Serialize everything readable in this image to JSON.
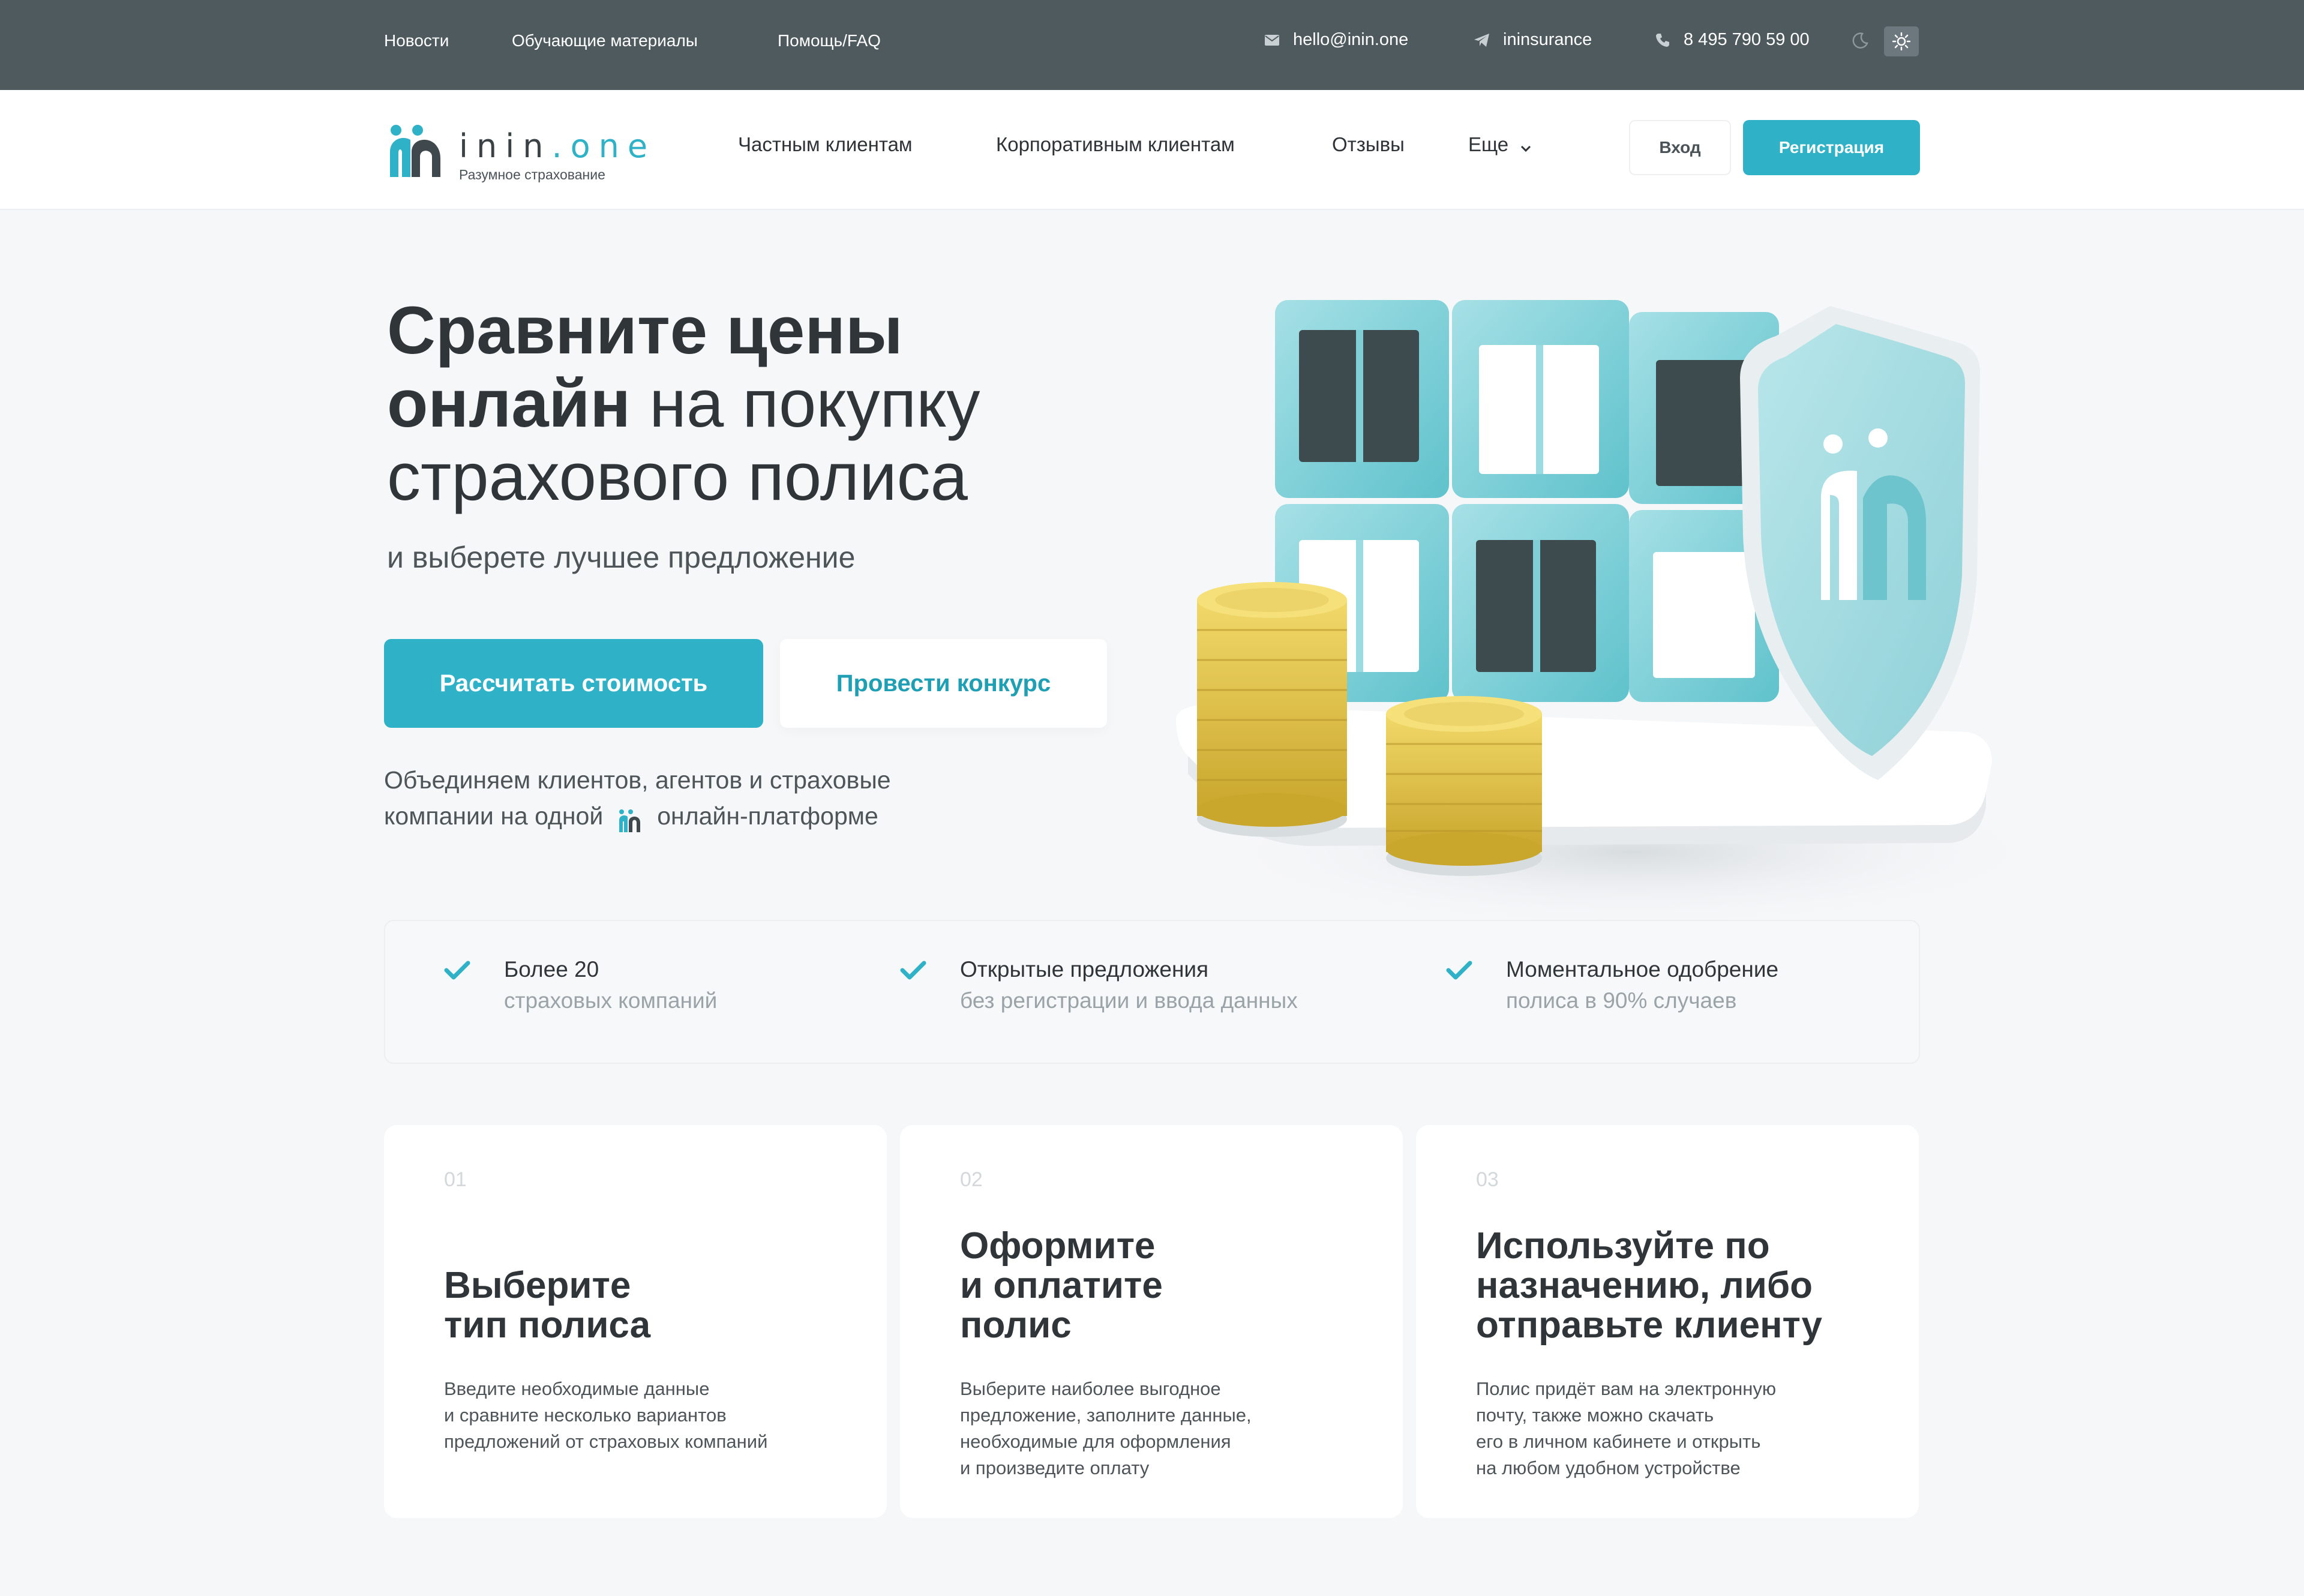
{
  "topbar": {
    "links": [
      "Новости",
      "Обучающие материалы",
      "Помощь/FAQ"
    ],
    "email": "hello@inin.one",
    "telegram": "ininsurance",
    "phone": "8 495 790 59 00",
    "icons": [
      "mail-icon",
      "telegram-icon",
      "phone-icon",
      "moon-icon",
      "sun-icon"
    ]
  },
  "header": {
    "logo_name": "inin",
    "logo_domain": "one",
    "logo_tagline": "Разумное страхование",
    "nav": [
      "Частным клиентам",
      "Корпоративным клиентам",
      "Отзывы",
      "Еще"
    ],
    "login": "Вход",
    "register": "Регистрация"
  },
  "hero": {
    "title_line1": "Сравните цены",
    "title_line2_bold": "онлайн",
    "title_line2_rest": " на покупку",
    "title_line3": "страхового полиса",
    "subtitle": "и выберете лучшее предложение",
    "btn_primary": "Рассчитать стоимость",
    "btn_secondary": "Провести конкурс",
    "desc_line1": "Объединяем клиентов, агентов и страховые",
    "desc_line2_a": "компании на одной",
    "desc_line2_b": "онлайн-платформе"
  },
  "features": [
    {
      "line1": "Более 20",
      "line2": "страховых компаний"
    },
    {
      "line1": "Открытые предложения",
      "line2": "без регистрации и ввода данных"
    },
    {
      "line1": "Моментальное одобрение",
      "line2": "полиса в 90% случаев"
    }
  ],
  "steps": [
    {
      "num": "01",
      "title": "Выберите\nтип полиса",
      "text": "Введите необходимые данные\nи сравните несколько вариантов\nпредложений от страховых компаний"
    },
    {
      "num": "02",
      "title": "Оформите\nи оплатите\nполис",
      "text": "Выберите наиболее выгодное\nпредложение, заполните данные,\nнеобходимые для оформления\nи произведите оплату"
    },
    {
      "num": "03",
      "title": "Используйте по\nназначению, либо\nотправьте клиенту",
      "text": "Полис придёт вам на электронную\nпочту, также можно скачать\nего в личном кабинете и открыть\nна любом удобном устройстве"
    }
  ],
  "colors": {
    "accent": "#2fb2c8",
    "topbar": "#4f5a5f",
    "text": "#2f3538",
    "muted": "#9aa3a7"
  }
}
